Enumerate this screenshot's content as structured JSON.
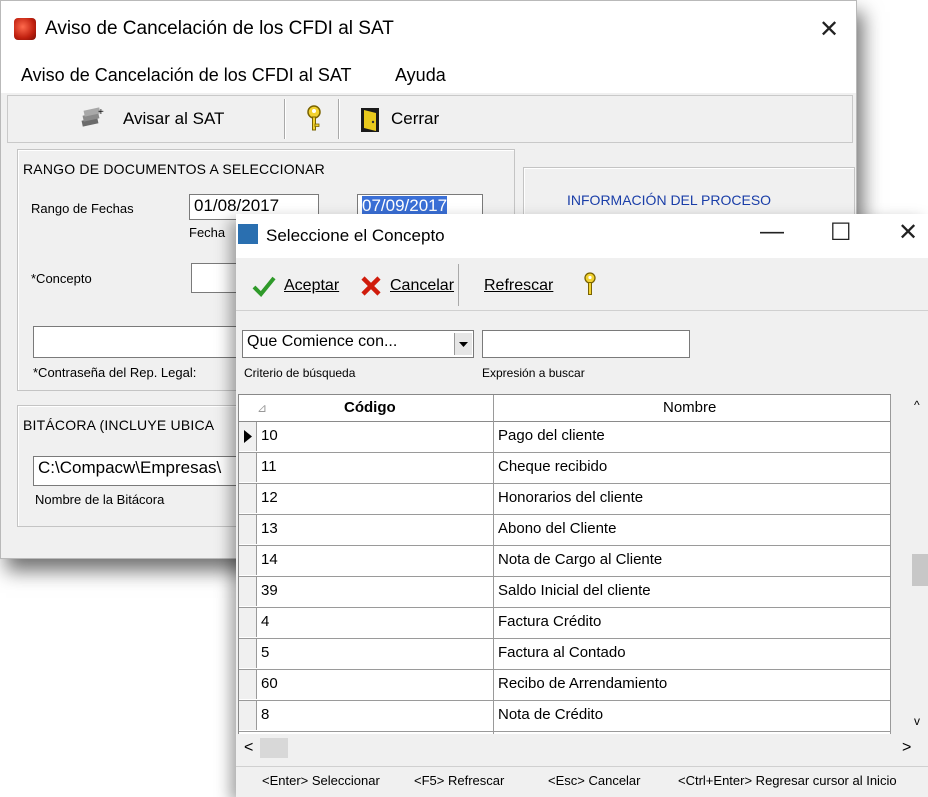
{
  "main": {
    "title": "Aviso de Cancelación de los CFDI al SAT",
    "menu": [
      "Aviso de Cancelación de los CFDI al SAT",
      "Ayuda"
    ],
    "toolbar": {
      "notify_label": "Avisar al SAT",
      "help_icon": "key-icon",
      "close_label": "Cerrar"
    },
    "range_group_title": "RANGO DE DOCUMENTOS A SELECCIONAR",
    "date_range_label": "Rango de Fechas",
    "date_from": "01/08/2017",
    "date_to": "07/09/2017",
    "date_caption": "Fecha",
    "concept_label": "*Concepto",
    "password_label": "*Contraseña del Rep. Legal:",
    "info_title": "INFORMACIÓN DEL PROCESO",
    "log_group_title": "BITÁCORA (INCLUYE UBICA",
    "log_path": "C:\\Compacw\\Empresas\\",
    "log_caption": "Nombre de la Bitácora"
  },
  "dialog": {
    "title": "Seleccione el Concepto",
    "accept_label": "Aceptar",
    "cancel_label": "Cancelar",
    "refresh_label": "Refrescar",
    "criteria_value": "Que Comience con...",
    "criteria_label": "Criterio de búsqueda",
    "expression_value": "",
    "expression_label": "Expresión a buscar",
    "columns": [
      "Código",
      "Nombre"
    ],
    "rows": [
      {
        "code": "10",
        "name": "Pago del cliente"
      },
      {
        "code": "11",
        "name": "Cheque recibido"
      },
      {
        "code": "12",
        "name": "Honorarios del cliente"
      },
      {
        "code": "13",
        "name": "Abono del Cliente"
      },
      {
        "code": "14",
        "name": "Nota de Cargo al Cliente"
      },
      {
        "code": "39",
        "name": "Saldo Inicial del cliente"
      },
      {
        "code": "4",
        "name": "Factura Crédito"
      },
      {
        "code": "5",
        "name": "Factura al Contado"
      },
      {
        "code": "60",
        "name": "Recibo de Arrendamiento"
      },
      {
        "code": "8",
        "name": "Nota de Crédito"
      }
    ],
    "hints": [
      "<Enter> Seleccionar",
      "<F5> Refrescar",
      "<Esc> Cancelar",
      "<Ctrl+Enter> Regresar cursor al Inicio"
    ]
  }
}
